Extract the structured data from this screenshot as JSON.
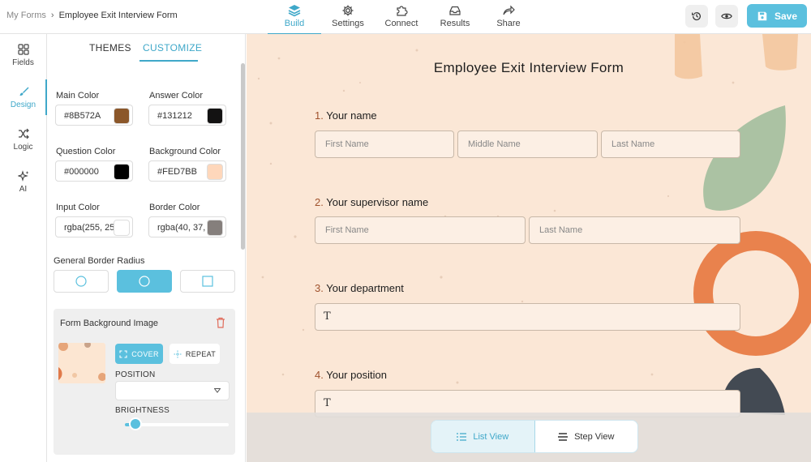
{
  "colors": {
    "accent": "#3fa8c9",
    "save_bg": "#5bc0de",
    "main_color_swatch": "#8B572A",
    "answer_color_swatch": "#131212",
    "question_color_swatch": "#000000",
    "background_color_swatch": "#FED7BB",
    "input_color_swatch": "#ffffff",
    "border_color_swatch": "#857f7c",
    "canvas_bg": "#fbe7d6"
  },
  "header": {
    "breadcrumb_root": "My Forms",
    "breadcrumb_separator": "›",
    "breadcrumb_current": "Employee Exit Interview Form",
    "tabs": [
      {
        "label": "Build",
        "icon": "layers-icon",
        "active": true
      },
      {
        "label": "Settings",
        "icon": "gear-icon"
      },
      {
        "label": "Connect",
        "icon": "puzzle-icon"
      },
      {
        "label": "Results",
        "icon": "inbox-icon"
      },
      {
        "label": "Share",
        "icon": "share-arrow-icon"
      }
    ],
    "save_label": "Save"
  },
  "rail": {
    "items": [
      {
        "label": "Fields",
        "icon": "grid-icon"
      },
      {
        "label": "Design",
        "icon": "brush-icon",
        "active": true
      },
      {
        "label": "Logic",
        "icon": "shuffle-icon"
      },
      {
        "label": "AI",
        "icon": "sparkle-icon"
      }
    ]
  },
  "panel": {
    "tab_themes": "THEMES",
    "tab_customize": "CUSTOMIZE",
    "main_color": {
      "label": "Main Color",
      "value": "#8B572A"
    },
    "answer_color": {
      "label": "Answer Color",
      "value": "#131212"
    },
    "question_color": {
      "label": "Question Color",
      "value": "#000000"
    },
    "background_color": {
      "label": "Background Color",
      "value": "#FED7BB"
    },
    "input_color": {
      "label": "Input Color",
      "value": "rgba(255, 25"
    },
    "border_color": {
      "label": "Border Color",
      "value": "rgba(40, 37,"
    },
    "border_radius_label": "General Border Radius",
    "bg_image": {
      "title": "Form Background Image",
      "cover": "COVER",
      "repeat": "REPEAT",
      "position_label": "POSITION",
      "position_value": "",
      "brightness_label": "BRIGHTNESS",
      "brightness": 0.1
    }
  },
  "form": {
    "title": "Employee Exit Interview Form",
    "q1": {
      "num": "1.",
      "label": "Your name",
      "first": "First Name",
      "middle": "Middle Name",
      "last": "Last Name"
    },
    "q2": {
      "num": "2.",
      "label": "Your supervisor name",
      "first": "First Name",
      "last": "Last Name"
    },
    "q3": {
      "num": "3.",
      "label": "Your department",
      "glyph": "T"
    },
    "q4": {
      "num": "4.",
      "label": "Your position",
      "glyph": "T"
    }
  },
  "view_toggle": {
    "list": "List View",
    "step": "Step View"
  }
}
